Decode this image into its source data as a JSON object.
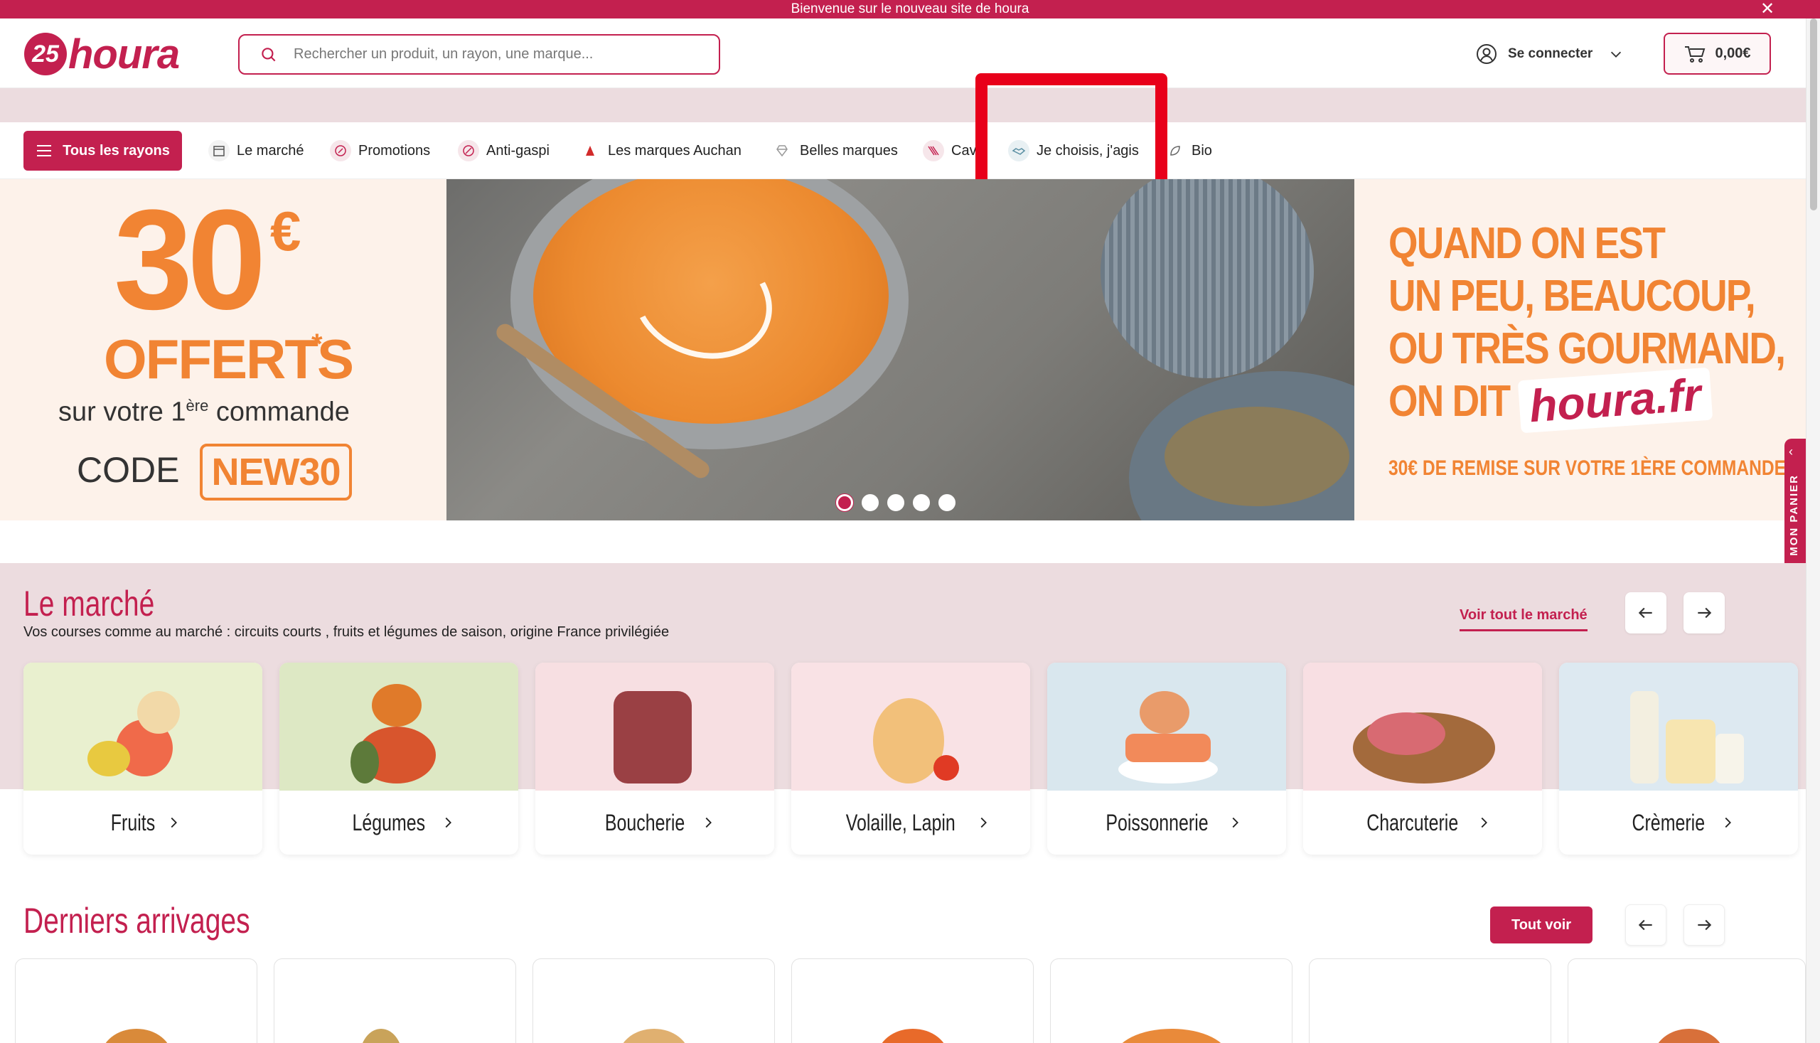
{
  "announcement": {
    "text": "Bienvenue sur le nouveau site de houra",
    "close_icon": "close-icon"
  },
  "header": {
    "logo_badge": "25",
    "logo_text": "houra",
    "search_placeholder": "Rechercher un produit, un rayon, une marque...",
    "login_label": "Se connecter",
    "cart_amount": "0,00€"
  },
  "nav": {
    "all_label": "Tous les rayons",
    "items": [
      {
        "label": "Le marché",
        "icon": "market-stall-icon"
      },
      {
        "label": "Promotions",
        "icon": "percent-icon"
      },
      {
        "label": "Anti-gaspi",
        "icon": "anti-waste-icon"
      },
      {
        "label": "Les marques Auchan",
        "icon": "auchan-brand-icon"
      },
      {
        "label": "Belles marques",
        "icon": "diamond-icon"
      },
      {
        "label": "Cav",
        "icon": "wine-icon"
      },
      {
        "label": "Je choisis, j'agis",
        "icon": "handshake-icon"
      },
      {
        "label": "Bio",
        "icon": "leaf-icon"
      }
    ]
  },
  "hero": {
    "left": {
      "amount": "30",
      "currency": "€",
      "offerts": "OFFERTS",
      "star": "*",
      "sur": "sur votre 1",
      "sup": "ère",
      "commande": " commande",
      "code_label": "CODE",
      "code_value": "NEW30"
    },
    "right": {
      "line1": "QUAND ON EST",
      "line2": "UN PEU, BEAUCOUP,",
      "line3": "OU TRÈS GOURMAND,",
      "line4": "ON DIT",
      "brand": "houra.fr",
      "remise": "30€ DE REMISE SUR VOTRE 1ÈRE COMMANDE*"
    },
    "slides_count": 5,
    "active_slide": 1
  },
  "side_tab": {
    "label": "MON PANIER"
  },
  "marche": {
    "title": "Le marché",
    "subtitle": "Vos courses comme au marché : circuits courts , fruits et légumes de saison, origine France privilégiée",
    "voir_tout": "Voir tout le marché",
    "categories": [
      {
        "label": "Fruits",
        "bg": "#e9f0cf"
      },
      {
        "label": "Légumes",
        "bg": "#dde8c4"
      },
      {
        "label": "Boucherie",
        "bg": "#f7dfe2"
      },
      {
        "label": "Volaille, Lapin",
        "bg": "#f9e2e5"
      },
      {
        "label": "Poissonnerie",
        "bg": "#d9e7ee"
      },
      {
        "label": "Charcuterie",
        "bg": "#f8dfe3"
      },
      {
        "label": "Crèmerie",
        "bg": "#dde9f1"
      }
    ]
  },
  "arrivages": {
    "title": "Derniers arrivages",
    "tout_voir": "Tout voir"
  },
  "colors": {
    "brand": "#c3204f",
    "orange": "#f18433",
    "pink_band": "#ecdcdf",
    "highlight": "#e8001a"
  }
}
